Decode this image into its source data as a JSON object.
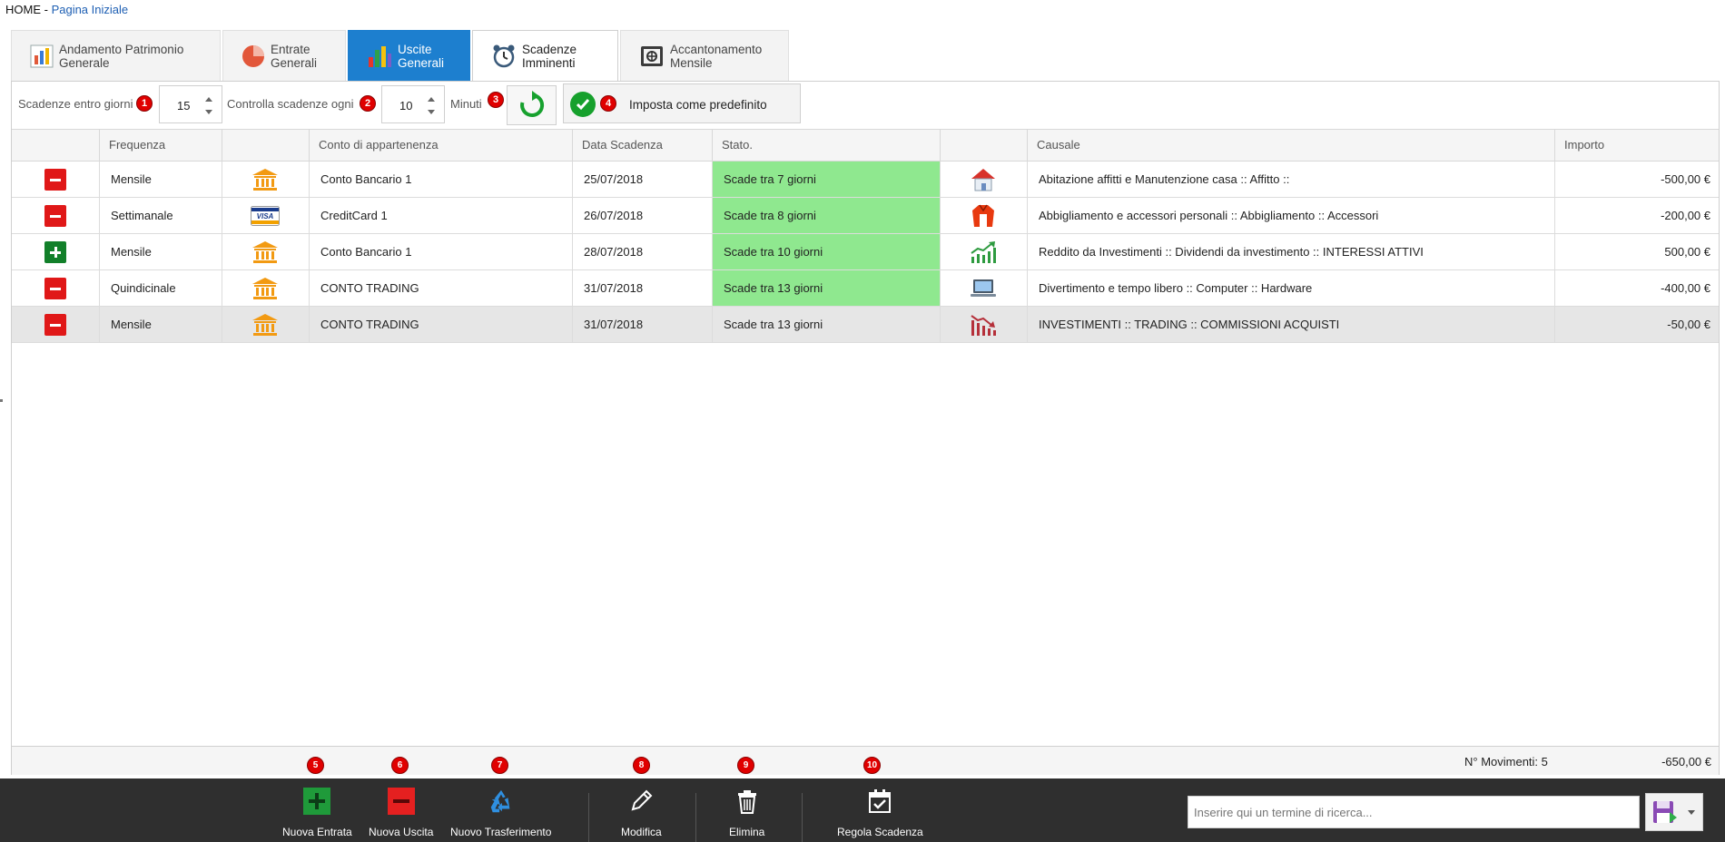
{
  "breadcrumb": {
    "home": "HOME",
    "separator": " - ",
    "page": "Pagina Iniziale"
  },
  "tabs": [
    {
      "label": "Andamento Patrimonio Generale",
      "icon": "patrimonio-chart-icon",
      "state": "normal"
    },
    {
      "label": "Entrate Generali",
      "icon": "pie-chart-icon",
      "state": "normal"
    },
    {
      "label": "Uscite Generali",
      "icon": "bar-chart-icon",
      "state": "highlighted"
    },
    {
      "label": "Scadenze Imminenti",
      "icon": "alarm-clock-icon",
      "state": "selected"
    },
    {
      "label": "Accantonamento Mensile",
      "icon": "safe-icon",
      "state": "normal"
    }
  ],
  "toolbar": {
    "days_label": "Scadenze entro giorni",
    "days_value": "15",
    "check_label": "Controlla scadenze ogni",
    "check_value": "10",
    "minutes_label": "Minuti",
    "default_label": "Imposta come predefinito",
    "badges": [
      "1",
      "2",
      "3",
      "4"
    ]
  },
  "grid": {
    "columns": [
      "",
      "Frequenza",
      "",
      "Conto di appartenenza",
      "Data Scadenza",
      "Stato.",
      "",
      "Causale",
      "Importo"
    ],
    "rows": [
      {
        "type": "minus",
        "frequenza": "Mensile",
        "conto_icon": "bank-icon",
        "conto": "Conto Bancario 1",
        "data": "25/07/2018",
        "stato": "Scade tra 7 giorni",
        "stato_highlight": true,
        "cat_icon": "house-icon",
        "causale": "Abitazione affitti e Manutenzione casa :: Affitto ::",
        "importo": "-500,00 €",
        "importo_kind": "neg"
      },
      {
        "type": "minus",
        "frequenza": "Settimanale",
        "conto_icon": "visa-card-icon",
        "conto": "CreditCard 1",
        "data": "26/07/2018",
        "stato": "Scade tra 8 giorni",
        "stato_highlight": true,
        "cat_icon": "jacket-icon",
        "causale": "Abbigliamento e accessori personali :: Abbigliamento :: Accessori",
        "importo": "-200,00 €",
        "importo_kind": "neg"
      },
      {
        "type": "plus",
        "frequenza": "Mensile",
        "conto_icon": "bank-icon",
        "conto": "Conto Bancario 1",
        "data": "28/07/2018",
        "stato": "Scade tra 10 giorni",
        "stato_highlight": true,
        "cat_icon": "trend-up-icon",
        "causale": "Reddito da Investimenti :: Dividendi da investimento :: INTERESSI ATTIVI",
        "importo": "500,00 €",
        "importo_kind": "pos"
      },
      {
        "type": "minus",
        "frequenza": "Quindicinale",
        "conto_icon": "bank-icon",
        "conto": "CONTO TRADING",
        "data": "31/07/2018",
        "stato": "Scade tra 13 giorni",
        "stato_highlight": true,
        "cat_icon": "computer-icon",
        "causale": "Divertimento e tempo libero :: Computer :: Hardware",
        "importo": "-400,00 €",
        "importo_kind": "neg"
      },
      {
        "type": "minus",
        "frequenza": "Mensile",
        "conto_icon": "bank-icon",
        "conto": "CONTO TRADING",
        "data": "31/07/2018",
        "stato": "Scade tra 13 giorni",
        "stato_highlight": false,
        "cat_icon": "trend-down-icon",
        "causale": "INVESTIMENTI :: TRADING :: COMMISSIONI ACQUISTI",
        "importo": "-50,00 €",
        "importo_kind": "neutral"
      }
    ],
    "footer": {
      "movements_label": "N° Movimenti: 5",
      "total": "-650,00 €"
    }
  },
  "bottombar": {
    "buttons": [
      {
        "label": "Nuova Entrata",
        "icon": "add-green-icon",
        "badge": "5"
      },
      {
        "label": "Nuova Uscita",
        "icon": "remove-red-icon",
        "badge": "6"
      },
      {
        "label": "Nuovo Trasferimento",
        "icon": "transfer-recycle-icon",
        "badge": "7"
      },
      {
        "label": "Modifica",
        "icon": "pencil-icon",
        "badge": "8"
      },
      {
        "label": "Elimina",
        "icon": "trash-icon",
        "badge": "9"
      },
      {
        "label": "Regola Scadenza",
        "icon": "calendar-check-icon",
        "badge": "10"
      }
    ],
    "search_placeholder": "Inserire qui un termine di ricerca..."
  },
  "colors": {
    "tab_highlight": "#1d7fcf",
    "due_green": "#8fe88f",
    "negative": "#e00000",
    "positive": "#1a8a1a",
    "bottombar": "#2f2f2f"
  }
}
